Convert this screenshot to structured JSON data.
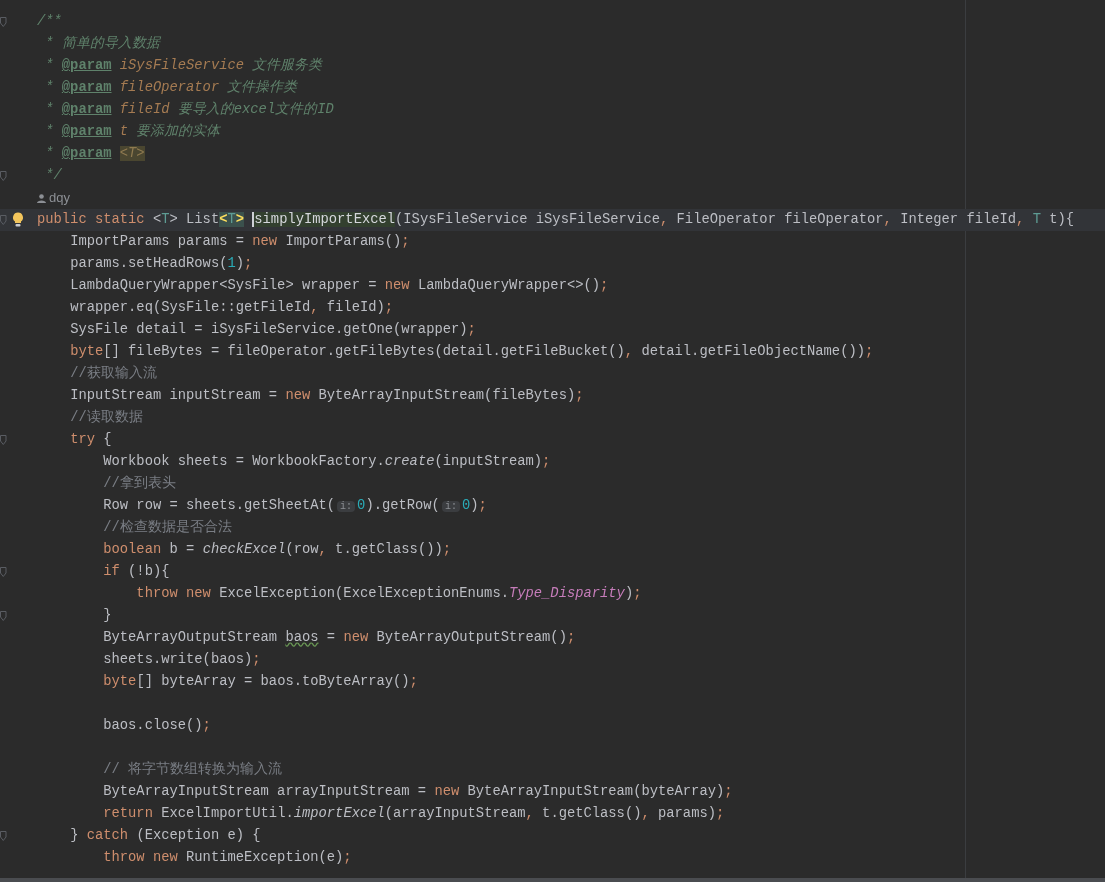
{
  "editor": {
    "lines": [
      {
        "fold": true,
        "intention": false,
        "current": false,
        "tokens": [
          {
            "text": "/**",
            "kind": "doc"
          }
        ]
      },
      {
        "fold": false,
        "intention": false,
        "current": false,
        "tokens": [
          {
            "text": " * 简单的导入数据",
            "kind": "doc"
          }
        ]
      },
      {
        "fold": false,
        "intention": false,
        "current": false,
        "tokens": [
          {
            "text": " * ",
            "kind": "doc"
          },
          {
            "text": "@param",
            "kind": "doctag"
          },
          {
            "text": " iSysFileService",
            "kind": "docparam"
          },
          {
            "text": " 文件服务类",
            "kind": "doc"
          }
        ]
      },
      {
        "fold": false,
        "intention": false,
        "current": false,
        "tokens": [
          {
            "text": " * ",
            "kind": "doc"
          },
          {
            "text": "@param",
            "kind": "doctag"
          },
          {
            "text": " fileOperator",
            "kind": "docparam"
          },
          {
            "text": " 文件操作类",
            "kind": "doc"
          }
        ]
      },
      {
        "fold": false,
        "intention": false,
        "current": false,
        "tokens": [
          {
            "text": " * ",
            "kind": "doc"
          },
          {
            "text": "@param",
            "kind": "doctag"
          },
          {
            "text": " fileId",
            "kind": "docparam"
          },
          {
            "text": " 要导入的excel文件的ID",
            "kind": "doc"
          }
        ]
      },
      {
        "fold": false,
        "intention": false,
        "current": false,
        "tokens": [
          {
            "text": " * ",
            "kind": "doc"
          },
          {
            "text": "@param",
            "kind": "doctag"
          },
          {
            "text": " t",
            "kind": "docparam"
          },
          {
            "text": " 要添加的实体",
            "kind": "doc"
          }
        ]
      },
      {
        "fold": false,
        "intention": false,
        "current": false,
        "tokens": [
          {
            "text": " * ",
            "kind": "doc"
          },
          {
            "text": "@param",
            "kind": "doctag"
          },
          {
            "text": "<T>",
            "kind": "docref"
          }
        ]
      },
      {
        "fold": true,
        "intention": false,
        "current": false,
        "tokens": [
          {
            "text": " */",
            "kind": "doc"
          }
        ]
      },
      {
        "fold": false,
        "intention": false,
        "current": false,
        "kind": "author",
        "tokens": [
          {
            "text": "dqy",
            "kind": "author"
          }
        ]
      },
      {
        "fold": true,
        "intention": true,
        "current": true,
        "tokens": [
          {
            "text": "public static ",
            "kind": "kw"
          },
          {
            "text": "<",
            "kind": "plain"
          },
          {
            "text": "T",
            "kind": "tparam"
          },
          {
            "text": "> List",
            "kind": "plain"
          },
          {
            "text": "<",
            "kind": "match"
          },
          {
            "text": "T",
            "kind": "matchparam"
          },
          {
            "text": ">",
            "kind": "match"
          },
          {
            "text": "simplyImportExcel",
            "kind": "usage",
            "caret": true
          },
          {
            "text": "(ISysFileService iSysFileService",
            "kind": "plain"
          },
          {
            "text": ", ",
            "kind": "punct"
          },
          {
            "text": "FileOperator fileOperator",
            "kind": "plain"
          },
          {
            "text": ", ",
            "kind": "punct"
          },
          {
            "text": "Integer fileId",
            "kind": "plain"
          },
          {
            "text": ", ",
            "kind": "punct"
          },
          {
            "text": "T",
            "kind": "tparam"
          },
          {
            "text": " t){",
            "kind": "plain"
          }
        ]
      },
      {
        "fold": false,
        "intention": false,
        "current": false,
        "tokens": [
          {
            "text": "    ImportParams params = ",
            "kind": "plain"
          },
          {
            "text": "new ",
            "kind": "kw"
          },
          {
            "text": "ImportParams()",
            "kind": "plain"
          },
          {
            "text": ";",
            "kind": "punct"
          }
        ]
      },
      {
        "fold": false,
        "intention": false,
        "current": false,
        "tokens": [
          {
            "text": "    params.setHeadRows(",
            "kind": "plain"
          },
          {
            "text": "1",
            "kind": "num"
          },
          {
            "text": ")",
            "kind": "plain"
          },
          {
            "text": ";",
            "kind": "punct"
          }
        ]
      },
      {
        "fold": false,
        "intention": false,
        "current": false,
        "tokens": [
          {
            "text": "    LambdaQueryWrapper<SysFile> wrapper = ",
            "kind": "plain"
          },
          {
            "text": "new ",
            "kind": "kw"
          },
          {
            "text": "LambdaQueryWrapper<>()",
            "kind": "plain"
          },
          {
            "text": ";",
            "kind": "punct"
          }
        ]
      },
      {
        "fold": false,
        "intention": false,
        "current": false,
        "tokens": [
          {
            "text": "    wrapper.eq(SysFile::getFileId",
            "kind": "plain"
          },
          {
            "text": ", ",
            "kind": "punct"
          },
          {
            "text": "fileId)",
            "kind": "plain"
          },
          {
            "text": ";",
            "kind": "punct"
          }
        ]
      },
      {
        "fold": false,
        "intention": false,
        "current": false,
        "tokens": [
          {
            "text": "    SysFile detail = iSysFileService.getOne(wrapper)",
            "kind": "plain"
          },
          {
            "text": ";",
            "kind": "punct"
          }
        ]
      },
      {
        "fold": false,
        "intention": false,
        "current": false,
        "tokens": [
          {
            "text": "    byte",
            "kind": "kw"
          },
          {
            "text": "[] fileBytes = fileOperator.getFileBytes(detail.getFileBucket()",
            "kind": "plain"
          },
          {
            "text": ", ",
            "kind": "punct"
          },
          {
            "text": "detail.getFileObjectName())",
            "kind": "plain"
          },
          {
            "text": ";",
            "kind": "punct"
          }
        ]
      },
      {
        "fold": false,
        "intention": false,
        "current": false,
        "tokens": [
          {
            "text": "    //获取输入流",
            "kind": "comment"
          }
        ]
      },
      {
        "fold": false,
        "intention": false,
        "current": false,
        "tokens": [
          {
            "text": "    InputStream inputStream = ",
            "kind": "plain"
          },
          {
            "text": "new ",
            "kind": "kw"
          },
          {
            "text": "ByteArrayInputStream(fileBytes)",
            "kind": "plain"
          },
          {
            "text": ";",
            "kind": "punct"
          }
        ]
      },
      {
        "fold": false,
        "intention": false,
        "current": false,
        "tokens": [
          {
            "text": "    //读取数据",
            "kind": "comment"
          }
        ]
      },
      {
        "fold": true,
        "intention": false,
        "current": false,
        "tokens": [
          {
            "text": "    try ",
            "kind": "kw"
          },
          {
            "text": "{",
            "kind": "plain"
          }
        ]
      },
      {
        "fold": false,
        "intention": false,
        "current": false,
        "tokens": [
          {
            "text": "        Workbook sheets = WorkbookFactory.",
            "kind": "plain"
          },
          {
            "text": "create",
            "kind": "static"
          },
          {
            "text": "(inputStream)",
            "kind": "plain"
          },
          {
            "text": ";",
            "kind": "punct"
          }
        ]
      },
      {
        "fold": false,
        "intention": false,
        "current": false,
        "tokens": [
          {
            "text": "        //拿到表头",
            "kind": "comment"
          }
        ]
      },
      {
        "fold": false,
        "intention": false,
        "current": false,
        "tokens": [
          {
            "text": "        Row row = sheets.getSheetAt(",
            "kind": "plain"
          },
          {
            "text": "i:",
            "kind": "hint"
          },
          {
            "text": "0",
            "kind": "num"
          },
          {
            "text": ").getRow(",
            "kind": "plain"
          },
          {
            "text": "i:",
            "kind": "hint"
          },
          {
            "text": "0",
            "kind": "num"
          },
          {
            "text": ")",
            "kind": "plain"
          },
          {
            "text": ";",
            "kind": "punct"
          }
        ]
      },
      {
        "fold": false,
        "intention": false,
        "current": false,
        "tokens": [
          {
            "text": "        //检查数据是否合法",
            "kind": "comment"
          }
        ]
      },
      {
        "fold": false,
        "intention": false,
        "current": false,
        "tokens": [
          {
            "text": "        boolean ",
            "kind": "kw"
          },
          {
            "text": "b = ",
            "kind": "plain"
          },
          {
            "text": "checkExcel",
            "kind": "static"
          },
          {
            "text": "(row",
            "kind": "plain"
          },
          {
            "text": ", ",
            "kind": "punct"
          },
          {
            "text": "t.getClass())",
            "kind": "plain"
          },
          {
            "text": ";",
            "kind": "punct"
          }
        ]
      },
      {
        "fold": true,
        "intention": false,
        "current": false,
        "tokens": [
          {
            "text": "        if ",
            "kind": "kw"
          },
          {
            "text": "(!b){",
            "kind": "plain"
          }
        ]
      },
      {
        "fold": false,
        "intention": false,
        "current": false,
        "tokens": [
          {
            "text": "            throw new ",
            "kind": "kw"
          },
          {
            "text": "ExcelException(ExcelExceptionEnums.",
            "kind": "plain"
          },
          {
            "text": "Type_Disparity",
            "kind": "enum"
          },
          {
            "text": ")",
            "kind": "plain"
          },
          {
            "text": ";",
            "kind": "punct"
          }
        ]
      },
      {
        "fold": true,
        "intention": false,
        "current": false,
        "tokens": [
          {
            "text": "        }",
            "kind": "plain"
          }
        ]
      },
      {
        "fold": false,
        "intention": false,
        "current": false,
        "tokens": [
          {
            "text": "        ByteArrayOutputStream ",
            "kind": "plain"
          },
          {
            "text": "baos",
            "kind": "warn"
          },
          {
            "text": " = ",
            "kind": "plain"
          },
          {
            "text": "new ",
            "kind": "kw"
          },
          {
            "text": "ByteArrayOutputStream()",
            "kind": "plain"
          },
          {
            "text": ";",
            "kind": "punct"
          }
        ]
      },
      {
        "fold": false,
        "intention": false,
        "current": false,
        "tokens": [
          {
            "text": "        sheets.write(baos)",
            "kind": "plain"
          },
          {
            "text": ";",
            "kind": "punct"
          }
        ]
      },
      {
        "fold": false,
        "intention": false,
        "current": false,
        "tokens": [
          {
            "text": "        byte",
            "kind": "kw"
          },
          {
            "text": "[] byteArray = baos.toByteArray()",
            "kind": "plain"
          },
          {
            "text": ";",
            "kind": "punct"
          }
        ]
      },
      {
        "fold": false,
        "intention": false,
        "current": false
      },
      {
        "fold": false,
        "intention": false,
        "current": false,
        "tokens": [
          {
            "text": "        baos.close()",
            "kind": "plain"
          },
          {
            "text": ";",
            "kind": "punct"
          }
        ]
      },
      {
        "fold": false,
        "intention": false,
        "current": false
      },
      {
        "fold": false,
        "intention": false,
        "current": false,
        "tokens": [
          {
            "text": "        // 将字节数组转换为输入流",
            "kind": "comment"
          }
        ]
      },
      {
        "fold": false,
        "intention": false,
        "current": false,
        "tokens": [
          {
            "text": "        ByteArrayInputStream arrayInputStream = ",
            "kind": "plain"
          },
          {
            "text": "new ",
            "kind": "kw"
          },
          {
            "text": "ByteArrayInputStream(byteArray)",
            "kind": "plain"
          },
          {
            "text": ";",
            "kind": "punct"
          }
        ]
      },
      {
        "fold": false,
        "intention": false,
        "current": false,
        "tokens": [
          {
            "text": "        return ",
            "kind": "kw"
          },
          {
            "text": "ExcelImportUtil.",
            "kind": "plain"
          },
          {
            "text": "importExcel",
            "kind": "static"
          },
          {
            "text": "(arrayInputStream",
            "kind": "plain"
          },
          {
            "text": ", ",
            "kind": "punct"
          },
          {
            "text": "t.getClass()",
            "kind": "plain"
          },
          {
            "text": ", ",
            "kind": "punct"
          },
          {
            "text": "params)",
            "kind": "plain"
          },
          {
            "text": ";",
            "kind": "punct"
          }
        ]
      },
      {
        "fold": true,
        "intention": false,
        "current": false,
        "tokens": [
          {
            "text": "    } ",
            "kind": "plain"
          },
          {
            "text": "catch ",
            "kind": "kw"
          },
          {
            "text": "(Exception e) {",
            "kind": "plain"
          }
        ]
      },
      {
        "fold": false,
        "intention": false,
        "current": false,
        "tokens": [
          {
            "text": "        throw new ",
            "kind": "kw"
          },
          {
            "text": "RuntimeException(e)",
            "kind": "plain"
          },
          {
            "text": ";",
            "kind": "punct"
          }
        ]
      }
    ]
  }
}
